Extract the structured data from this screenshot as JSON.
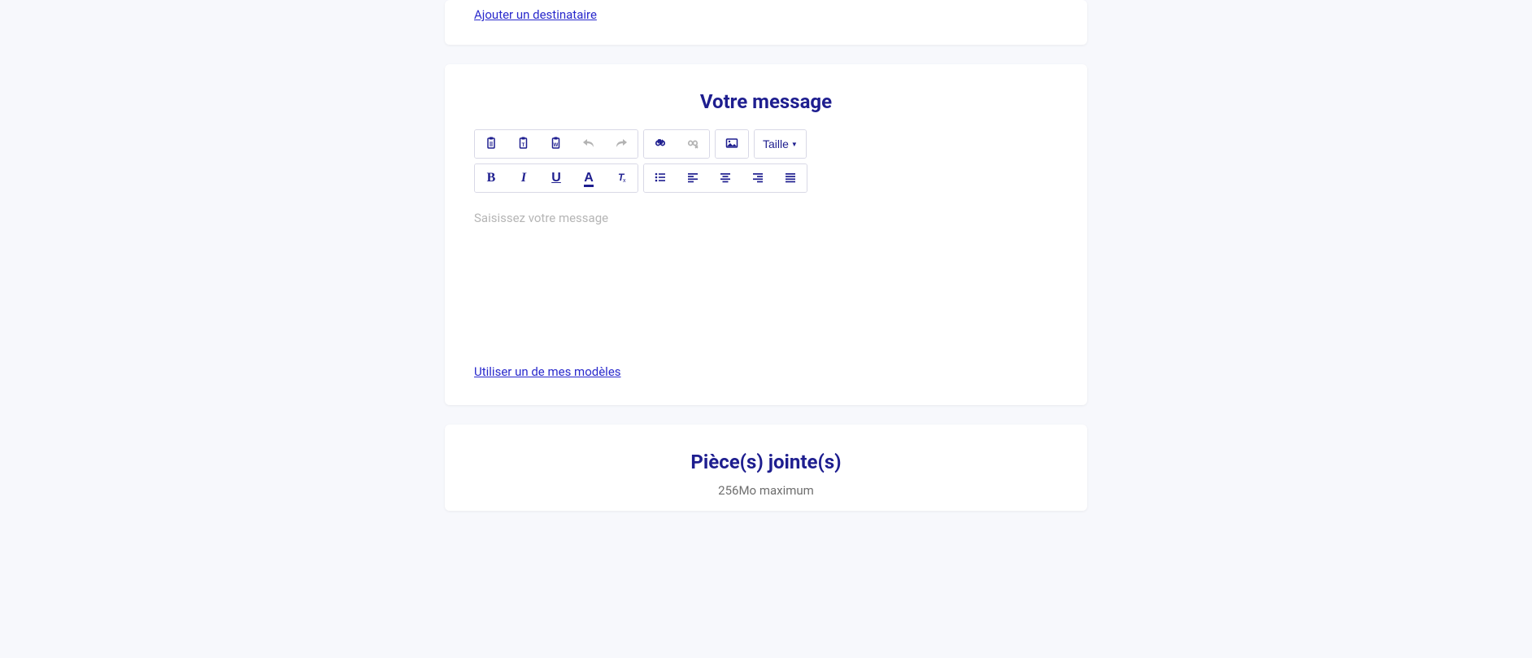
{
  "recipients": {
    "add_link": "Ajouter un destinataire"
  },
  "message": {
    "heading": "Votre message",
    "placeholder": "Saisissez votre message",
    "use_template_link": "Utiliser un de mes modèles",
    "toolbar": {
      "size_label": "Taille"
    }
  },
  "attachments": {
    "heading": "Pièce(s) jointe(s)",
    "limit": "256Mo maximum"
  }
}
